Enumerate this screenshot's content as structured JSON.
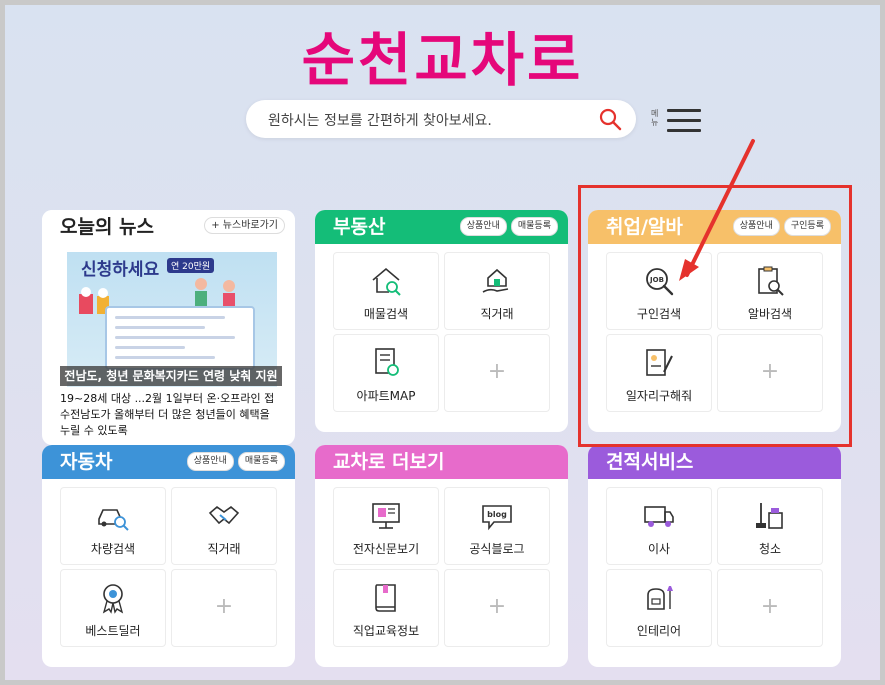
{
  "logo": "순천교차로",
  "search": {
    "placeholder": "원하시는 정보를 간편하게 찾아보세요."
  },
  "menu": {
    "label": "메뉴"
  },
  "news": {
    "title": "오늘의 뉴스",
    "more": "+ 뉴스바로가기",
    "image_title": "신청하세요",
    "image_badge": "연 20만원",
    "caption": "전남도, 청년 문화복지카드 연령 낮춰 지원",
    "text": "19~28세 대상 ...2월 1일부터 온·오프라인 접수전남도가 올해부터 더 많은 청년들이 혜택을 누릴 수 있도록"
  },
  "cards": {
    "realestate": {
      "title": "부동산",
      "tag1": "상품안내",
      "tag2": "매물등록",
      "items": [
        "매물검색",
        "직거래",
        "아파트MAP"
      ]
    },
    "jobs": {
      "title": "취업/알바",
      "tag1": "상품안내",
      "tag2": "구인등록",
      "items": [
        "구인검색",
        "알바검색",
        "일자리구해줘"
      ]
    },
    "car": {
      "title": "자동차",
      "tag1": "상품안내",
      "tag2": "매물등록",
      "items": [
        "차량검색",
        "직거래",
        "베스트딜러"
      ]
    },
    "more": {
      "title": "교차로 더보기",
      "items": [
        "전자신문보기",
        "공식블로그",
        "직업교육정보"
      ]
    },
    "estimate": {
      "title": "견적서비스",
      "items": [
        "이사",
        "청소",
        "인테리어"
      ]
    }
  },
  "colors": {
    "logo": "#e5077a",
    "realestate": "#14bd78",
    "jobs": "#f7c069",
    "car": "#3d93d8",
    "more": "#e76bcb",
    "estimate": "#9b5bdc",
    "highlight": "#e5322d"
  }
}
